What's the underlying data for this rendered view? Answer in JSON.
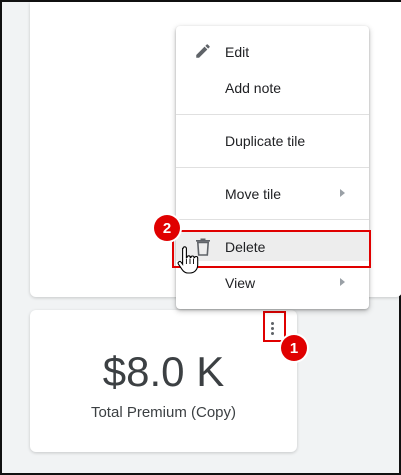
{
  "menu": {
    "items": [
      {
        "label": "Edit",
        "icon": "pencil-icon"
      },
      {
        "label": "Add note"
      },
      {
        "label": "Duplicate tile"
      },
      {
        "label": "Move tile",
        "submenu": true
      },
      {
        "label": "Delete",
        "icon": "trash-icon",
        "highlighted": true
      },
      {
        "label": "View",
        "submenu": true
      }
    ]
  },
  "tile": {
    "value": "$8.0 K",
    "label": "Total Premium (Copy)"
  },
  "annotations": {
    "badge1": "1",
    "badge2": "2",
    "color": "#e00000"
  }
}
